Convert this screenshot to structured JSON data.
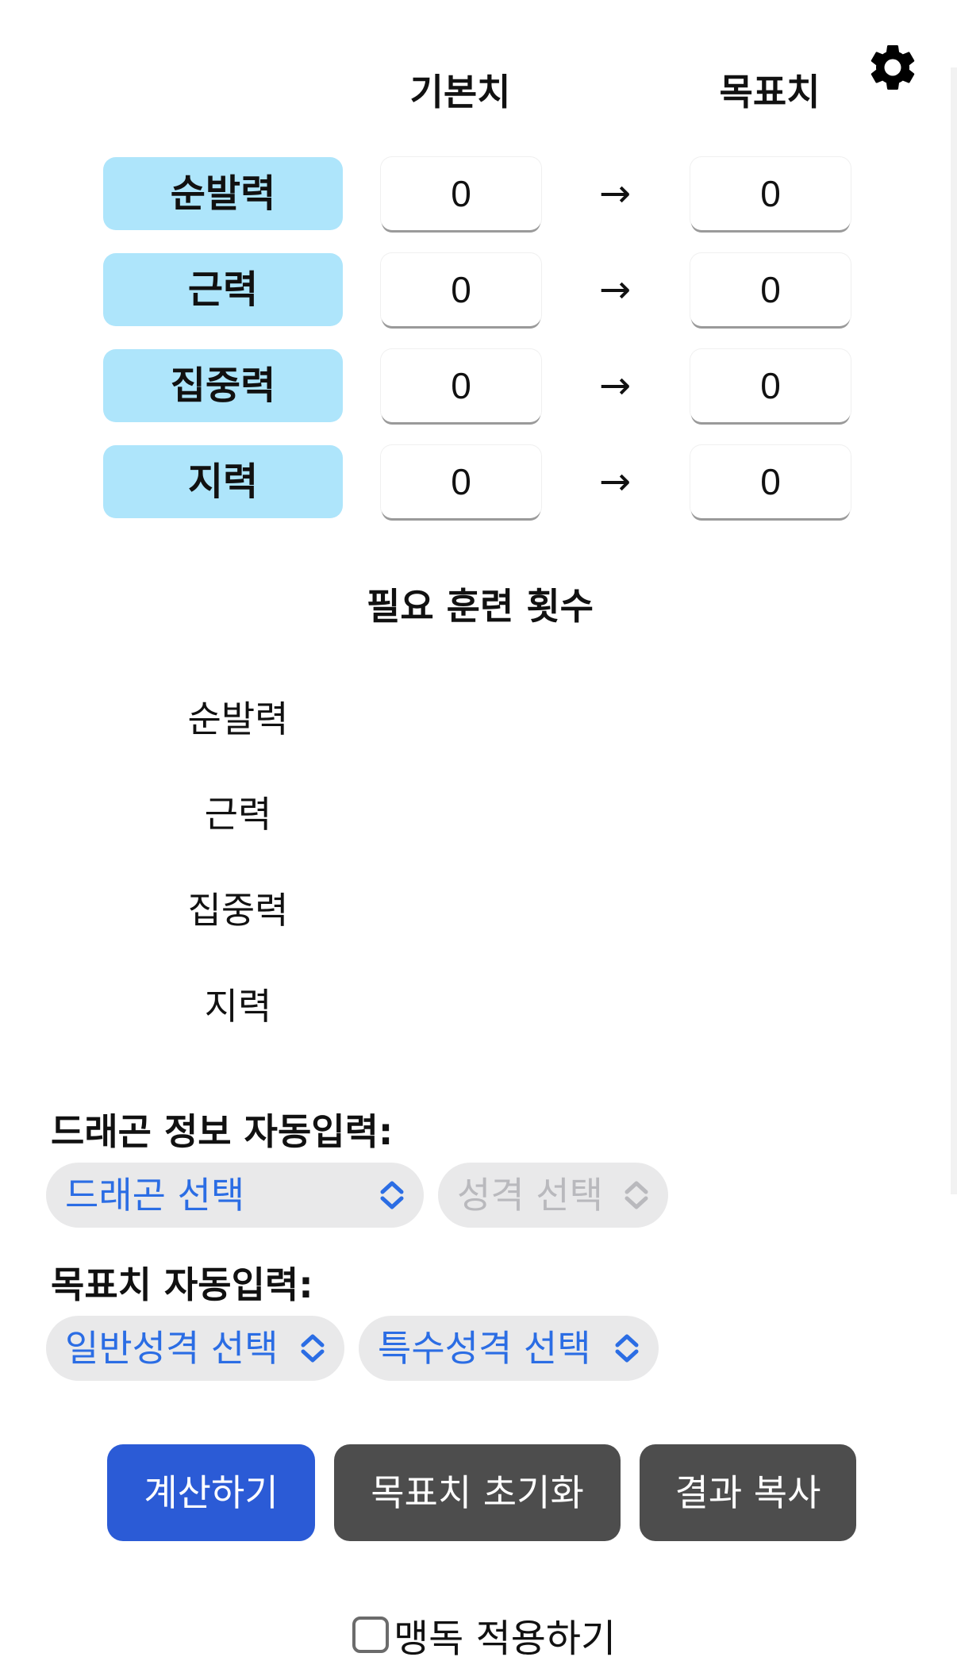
{
  "header": {
    "base_label": "기본치",
    "target_label": "목표치",
    "settings_icon": "gear-icon"
  },
  "stats": [
    {
      "label": "순발력",
      "base": "0",
      "arrow": "→",
      "target": "0"
    },
    {
      "label": "근력",
      "base": "0",
      "arrow": "→",
      "target": "0"
    },
    {
      "label": "집중력",
      "base": "0",
      "arrow": "→",
      "target": "0"
    },
    {
      "label": "지력",
      "base": "0",
      "arrow": "→",
      "target": "0"
    }
  ],
  "results": {
    "title": "필요 훈련 횟수",
    "rows": [
      "순발력",
      "근력",
      "집중력",
      "지력"
    ]
  },
  "dragon_autofill": {
    "label": "드래곤 정보 자동입력:",
    "dragon_select": "드래곤 선택",
    "personality_select": "성격 선택"
  },
  "target_autofill": {
    "label": "목표치 자동입력:",
    "normal_select": "일반성격 선택",
    "special_select": "특수성격 선택"
  },
  "buttons": {
    "calculate": "계산하기",
    "reset_target": "목표치 초기화",
    "copy_result": "결과 복사"
  },
  "option": {
    "poison_label": "맹독 적용하기",
    "poison_checked": false
  },
  "colors": {
    "stat_label_bg": "#aee5fb",
    "select_text": "#2b6de4",
    "primary_button": "#2b5bd6",
    "dark_button": "#4d4d4d"
  }
}
